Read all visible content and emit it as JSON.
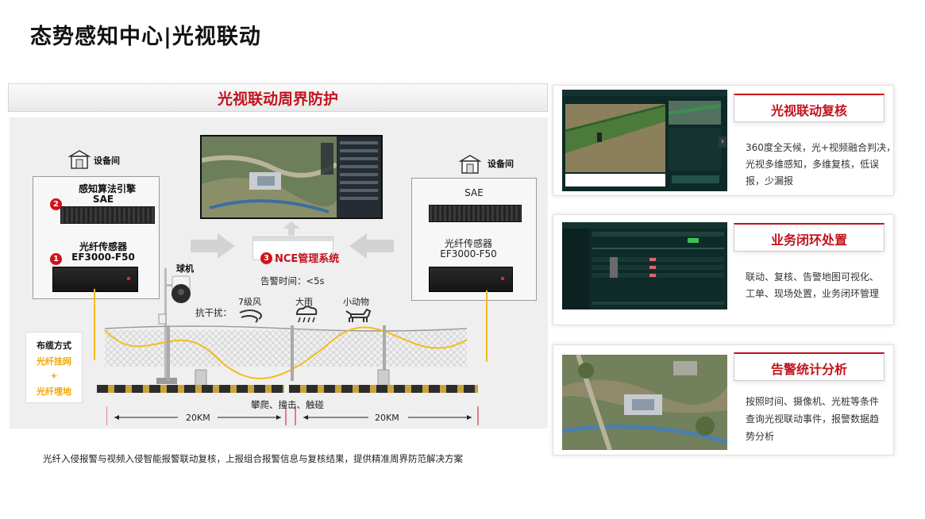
{
  "page": {
    "title": "态势感知中心|光视联动"
  },
  "diagram": {
    "banner": "光视联动周界防护",
    "left_room": {
      "label": "设备间"
    },
    "right_room": {
      "label": "设备间"
    },
    "left_rack": {
      "engine_label": "感知算法引擎",
      "engine_model": "SAE",
      "engine_badge": "2",
      "sensor_label": "光纤传感器",
      "sensor_model": "EF3000-F50",
      "sensor_badge": "1"
    },
    "right_rack": {
      "engine_model": "SAE",
      "sensor_label": "光纤传感器",
      "sensor_model": "EF3000-F50"
    },
    "camera_label": "球机",
    "nce": {
      "badge": "3",
      "label": "NCE管理系统"
    },
    "alarm_time": "告警时间：<5s",
    "anti_interference": {
      "label": "抗干扰：",
      "items": [
        "7级风",
        "大雨",
        "小动物"
      ]
    },
    "cabling": {
      "title": "布缆方式",
      "option1": "光纤挂网",
      "plus": "+",
      "option2": "光纤埋地"
    },
    "events": "攀爬、撞击、触碰",
    "dist_left": "20KM",
    "dist_right": "20KM",
    "footer": "光纤入侵报警与视频入侵智能报警联动复核，上报组合报警信息与复核结果，提供精准周界防范解决方案"
  },
  "cards": [
    {
      "title": "光视联动复核",
      "desc_lines": [
        "360度全天候，光+视频融合判决，",
        "光视多维感知，多维复核，低误",
        "报，少漏报"
      ]
    },
    {
      "title": "业务闭环处置",
      "desc_lines": [
        "联动、复核、告警地图可视化、",
        "工单、现场处置，业务闭环管理"
      ]
    },
    {
      "title": "告警统计分析",
      "desc_lines": [
        "按照时间、摄像机、光桩等条件",
        "查询光视联动事件，报警数据趋",
        "势分析"
      ]
    }
  ],
  "colors": {
    "accent": "#c3121c",
    "fiber": "#f2bd1a",
    "cabling_text": "#f0a800"
  }
}
